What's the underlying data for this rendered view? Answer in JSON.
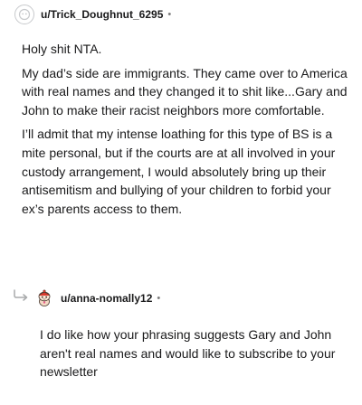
{
  "comments": [
    {
      "username": "u/Trick_Doughnut_6295",
      "separator": "•",
      "paragraphs": [
        "Holy shit NTA.",
        "My dad’s side are immigrants. They came over to America with real names and they changed it to shit like...Gary and John to make their racist neighbors more comfortable.",
        "I’ll admit that my intense loathing for this type of BS is a mite personal, but if the courts are at all involved in your custody arrangement, I would absolutely bring up their antisemitism and bullying of your children to forbid your ex’s parents access to them."
      ]
    },
    {
      "username": "u/anna-nomally12",
      "separator": "•",
      "paragraphs": [
        "I do like how your phrasing suggests Gary and John aren't real names and would like to subscribe to your newsletter"
      ]
    }
  ],
  "colors": {
    "text": "#1a1a1b",
    "meta": "#7c7c7c",
    "avatar_border": "#c7c9cc"
  },
  "icons": {
    "avatar_1": "default-avatar-icon",
    "reply": "reply-arrow-icon",
    "avatar_2": "snoo-avatar-icon"
  }
}
